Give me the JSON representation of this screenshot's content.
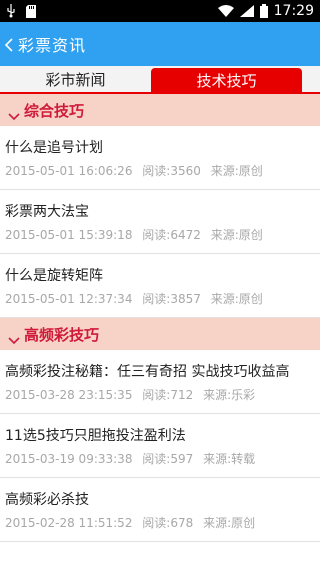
{
  "status_bar": {
    "time": "17:29",
    "icons": [
      "usb-icon",
      "sd-card-icon",
      "wifi-icon",
      "signal-icon",
      "battery-icon"
    ]
  },
  "action_bar": {
    "title": "彩票资讯",
    "color": "#2fa1f0"
  },
  "tabs": [
    {
      "label": "彩市新闻",
      "active": false
    },
    {
      "label": "技术技巧",
      "active": true
    }
  ],
  "sections": [
    {
      "title": "综合技巧",
      "items": [
        {
          "title": "什么是追号计划",
          "datetime": "2015-05-01 16:06:26",
          "reads": "阅读:3560",
          "source": "来源:原创"
        },
        {
          "title": "彩票两大法宝",
          "datetime": "2015-05-01 15:39:18",
          "reads": "阅读:6472",
          "source": "来源:原创"
        },
        {
          "title": "什么是旋转矩阵",
          "datetime": "2015-05-01 12:37:34",
          "reads": "阅读:3857",
          "source": "来源:原创"
        }
      ]
    },
    {
      "title": "高频彩技巧",
      "items": [
        {
          "title": "高频彩投注秘籍：任三有奇招 实战技巧收益高",
          "datetime": "2015-03-28 23:15:35",
          "reads": "阅读:712",
          "source": "来源:乐彩"
        },
        {
          "title": "11选5技巧只胆拖投注盈利法",
          "datetime": "2015-03-19 09:33:38",
          "reads": "阅读:597",
          "source": "来源:转载"
        },
        {
          "title": "高频彩必杀技",
          "datetime": "2015-02-28 11:51:52",
          "reads": "阅读:678",
          "source": "来源:原创"
        }
      ]
    }
  ],
  "colors": {
    "accent_red": "#e60000",
    "section_bg": "#f7d2c7",
    "section_text": "#d01a3a"
  }
}
